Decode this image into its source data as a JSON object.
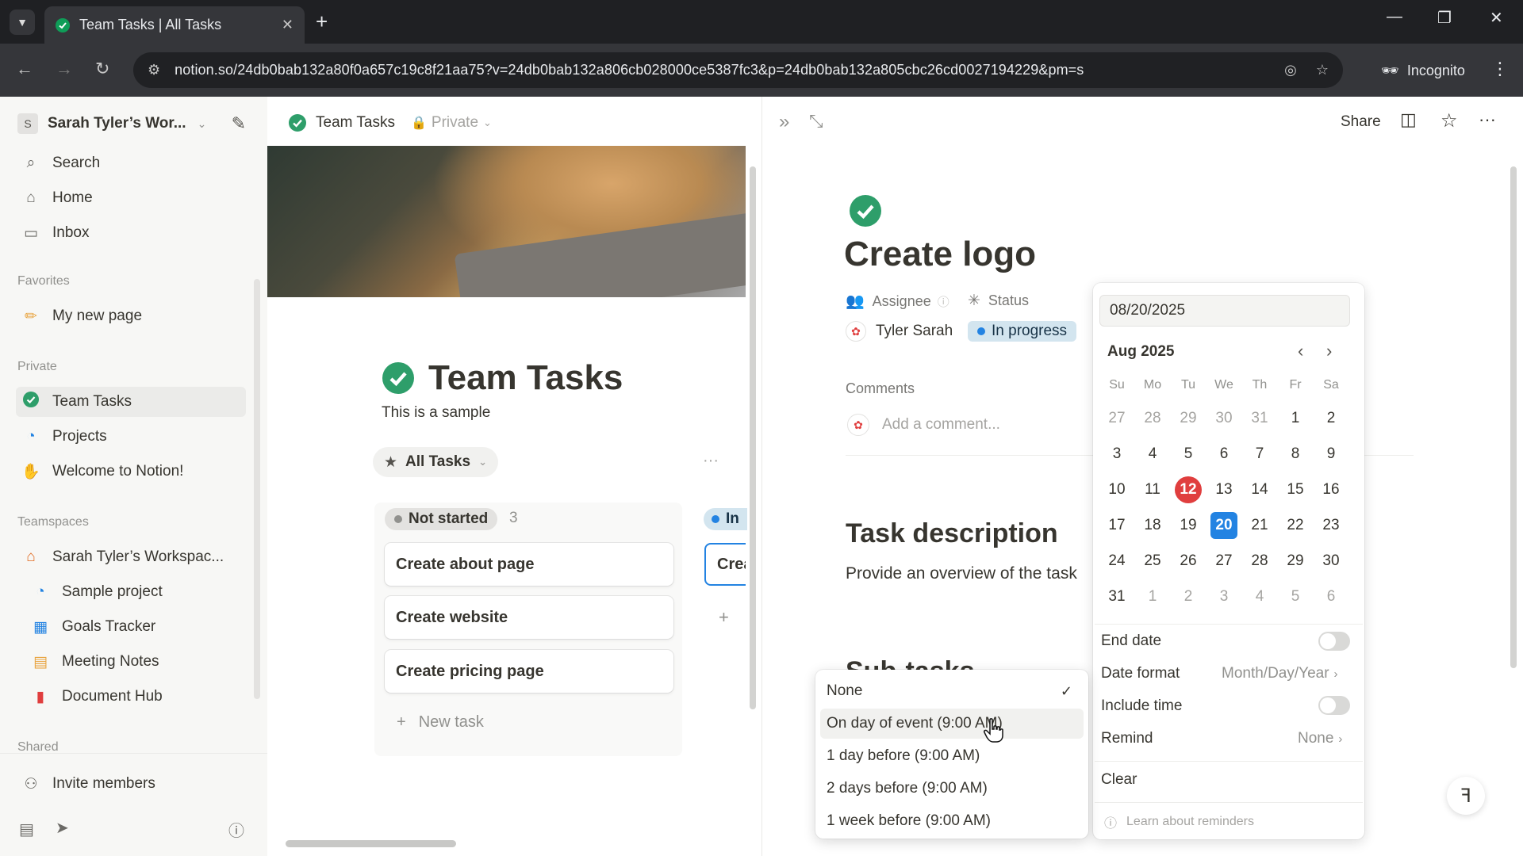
{
  "browser": {
    "tab_title": "Team Tasks | All Tasks",
    "url": "notion.so/24db0bab132a80f0a657c19c8f21aa75?v=24db0bab132a806cb028000ce5387fc3&p=24db0bab132a805cbc26cd0027194229&pm=s",
    "incognito_label": "Incognito"
  },
  "sidebar": {
    "workspace_name": "Sarah Tyler’s Wor...",
    "workspace_initial": "S",
    "top_items": [
      {
        "label": "Search",
        "icon": "search-icon"
      },
      {
        "label": "Home",
        "icon": "home-icon"
      },
      {
        "label": "Inbox",
        "icon": "inbox-icon"
      }
    ],
    "favorites_title": "Favorites",
    "favorites": [
      {
        "label": "My new page",
        "icon": "pencil-icon"
      }
    ],
    "private_title": "Private",
    "private": [
      {
        "label": "Team Tasks",
        "icon": "check-circle-icon"
      },
      {
        "label": "Projects",
        "icon": "projects-icon"
      },
      {
        "label": "Welcome to Notion!",
        "icon": "wave-icon"
      }
    ],
    "teamspaces_title": "Teamspaces",
    "teamspaces": [
      {
        "label": "Sarah Tyler’s Workspac...",
        "icon": "house-icon"
      },
      {
        "label": "Sample project",
        "icon": "projects-icon"
      },
      {
        "label": "Goals Tracker",
        "icon": "chart-icon"
      },
      {
        "label": "Meeting Notes",
        "icon": "calendar-icon"
      },
      {
        "label": "Document Hub",
        "icon": "document-icon"
      }
    ],
    "shared_title": "Shared",
    "invite_label": "Invite members"
  },
  "middle": {
    "breadcrumb_title": "Team Tasks",
    "privacy_label": "Private",
    "page_title": "Team Tasks",
    "page_description": "This is a sample",
    "view_name": "All Tasks",
    "group_not_started": "Not started",
    "group_not_started_count": "3",
    "group_in_progress": "In",
    "cards": [
      "Create about page",
      "Create website",
      "Create pricing page"
    ],
    "partial_card": "Crea",
    "new_task_label": "New task"
  },
  "detail": {
    "share_label": "Share",
    "title": "Create logo",
    "assignee_label": "Assignee",
    "status_label": "Status",
    "assignee_value": "Tyler Sarah",
    "status_value": "In progress",
    "comments_label": "Comments",
    "comment_placeholder": "Add a comment...",
    "description_heading": "Task description",
    "description_text": "Provide an overview of the task",
    "subtasks_heading": "Sub-tasks"
  },
  "calendar": {
    "date_value": "08/20/2025",
    "month_label": "Aug 2025",
    "weekdays": [
      "Su",
      "Mo",
      "Tu",
      "We",
      "Th",
      "Fr",
      "Sa"
    ],
    "weeks": [
      [
        "27",
        "28",
        "29",
        "30",
        "31",
        "1",
        "2"
      ],
      [
        "3",
        "4",
        "5",
        "6",
        "7",
        "8",
        "9"
      ],
      [
        "10",
        "11",
        "12",
        "13",
        "14",
        "15",
        "16"
      ],
      [
        "17",
        "18",
        "19",
        "20",
        "21",
        "22",
        "23"
      ],
      [
        "24",
        "25",
        "26",
        "27",
        "28",
        "29",
        "30"
      ],
      [
        "31",
        "1",
        "2",
        "3",
        "4",
        "5",
        "6"
      ]
    ],
    "today": "12",
    "selected": "20",
    "end_date_label": "End date",
    "date_format_label": "Date format",
    "date_format_value": "Month/Day/Year",
    "include_time_label": "Include time",
    "remind_label": "Remind",
    "remind_value": "None",
    "clear_label": "Clear",
    "learn_label": "Learn about reminders"
  },
  "remind_menu": {
    "options": [
      "None",
      "On day of event (9:00 AM)",
      "1 day before (9:00 AM)",
      "2 days before (9:00 AM)",
      "1 week before (9:00 AM)"
    ],
    "selected": "None",
    "hovered": "On day of event (9:00 AM)"
  },
  "colors": {
    "accent_blue": "#2383e2",
    "today_red": "#e03e3e",
    "status_bg": "#d3e5ef",
    "check_green": "#0f9d58"
  }
}
